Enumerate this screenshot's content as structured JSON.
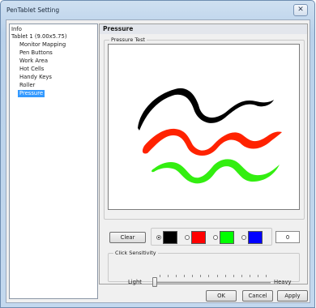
{
  "window": {
    "title": "PenTablet Setting",
    "close_glyph": "✕",
    "icons": [
      "close-icon"
    ]
  },
  "tree": {
    "items": [
      {
        "label": "Info"
      },
      {
        "label": "Tablet 1 (9.00x5.75)"
      },
      {
        "label": "Monitor Mapping"
      },
      {
        "label": "Pen Buttons"
      },
      {
        "label": "Work Area"
      },
      {
        "label": "Hot Cells"
      },
      {
        "label": "Handy Keys"
      },
      {
        "label": "Roller"
      },
      {
        "label": "Pressure",
        "selected": true
      }
    ]
  },
  "panel": {
    "title": "Pressure",
    "test_group_label": "Pressure Test",
    "clear_label": "Clear",
    "colors": [
      {
        "name": "black",
        "hex": "#000000",
        "selected": true
      },
      {
        "name": "red",
        "hex": "#ff0000",
        "selected": false
      },
      {
        "name": "green",
        "hex": "#00ff00",
        "selected": false
      },
      {
        "name": "blue",
        "hex": "#0000ff",
        "selected": false
      }
    ],
    "count_value": "0",
    "sensitivity": {
      "group_label": "Click Sensitivity",
      "low_label": "Light",
      "high_label": "Heavy",
      "level_fraction": 0.0,
      "tick_count": 14
    }
  },
  "strokes": [
    {
      "color": "#000000"
    },
    {
      "color": "#ff2200"
    },
    {
      "color": "#33ee11"
    }
  ],
  "buttons": {
    "ok": "OK",
    "cancel": "Cancel",
    "apply": "Apply"
  }
}
